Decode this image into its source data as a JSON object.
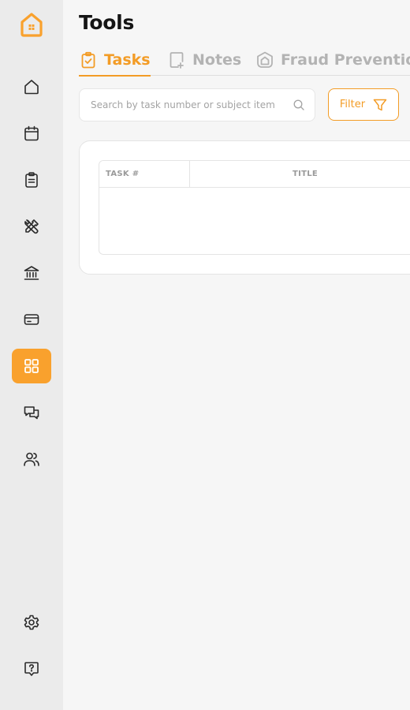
{
  "page": {
    "title": "Tools"
  },
  "colors": {
    "accent": "#f39c26",
    "active_nav_bg": "#f9a12d",
    "sidebar_bg": "#ebebeb",
    "page_bg": "#f6f6f6"
  },
  "sidebar": {
    "logo_icon": "home-logo-icon",
    "items": [
      {
        "icon": "home-icon",
        "active": false
      },
      {
        "icon": "calendar-icon",
        "active": false
      },
      {
        "icon": "clipboard-icon",
        "active": false
      },
      {
        "icon": "tools-icon",
        "active": false
      },
      {
        "icon": "bank-icon",
        "active": false
      },
      {
        "icon": "card-icon",
        "active": false
      },
      {
        "icon": "grid-icon",
        "active": true
      },
      {
        "icon": "chat-icon",
        "active": false
      },
      {
        "icon": "users-icon",
        "active": false
      }
    ],
    "bottom_items": [
      {
        "icon": "gear-icon"
      },
      {
        "icon": "help-icon"
      }
    ]
  },
  "tabs": [
    {
      "label": "Tasks",
      "icon": "clipboard-check-icon",
      "active": true
    },
    {
      "label": "Notes",
      "icon": "note-add-icon",
      "active": false
    },
    {
      "label": "Fraud Prevention",
      "icon": "shield-home-icon",
      "active": false
    }
  ],
  "search": {
    "placeholder": "Search by task number or subject item",
    "value": ""
  },
  "filter": {
    "label": "Filter",
    "icon": "filter-icon"
  },
  "table": {
    "columns": [
      "TASK #",
      "TITLE"
    ],
    "rows": []
  }
}
